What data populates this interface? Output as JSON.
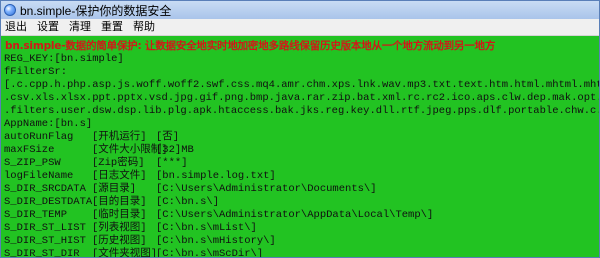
{
  "window": {
    "title": "bn.simple-保护你的数据安全",
    "icon": "app-logo-icon"
  },
  "menu": [
    "退出",
    "设置",
    "清理",
    "重置",
    "帮助"
  ],
  "headline": "bn.simple-数据的简单保护: 让数据安全地实时地加密地多路线保留历史版本地从一个地方流动到另一地方",
  "lines": {
    "reg_key": "REG_KEY:[bn.simple]",
    "filter_label": "fFilterSr:",
    "filter_1": "[.c.cpp.h.php.asp.js.woff.woff2.swf.css.mq4.amr.chm.xps.lnk.wav.mp3.txt.text.htm.html.mhtml.mht.pdf.doc.docx",
    "filter_2": ".csv.xls.xlsx.ppt.pptx.vsd.jpg.gif.png.bmp.java.rar.zip.bat.xml.rc.rc2.ico.aps.clw.dep.mak.opt.sln.vcxproj",
    "filter_3": ".filters.user.dsw.dsp.lib.plg.apk.htaccess.bak.jks.reg.key.dll.rtf.jpeg.pps.dlf.portable.chw.c.c.c.c.c.]",
    "app_name": "AppName:[bn.s]"
  },
  "settings": [
    {
      "key": "autoRunFlag",
      "label": "[开机运行]",
      "value": "[否]"
    },
    {
      "key": "maxFSize",
      "label": "[文件大小限制]",
      "value": "[32]MB"
    },
    {
      "key": "S_ZIP_PSW",
      "label": "[Zip密码]",
      "value": "[***]"
    },
    {
      "key": "logFileName",
      "label": "[日志文件]",
      "value": "[bn.simple.log.txt]"
    },
    {
      "key": "S_DIR_SRCDATA",
      "label": "[源目录]",
      "value": "[C:\\Users\\Administrator\\Documents\\]"
    },
    {
      "key": "S_DIR_DESTDATA",
      "label": "[目的目录]",
      "value": "[C:\\bn.s\\]"
    },
    {
      "key": "S_DIR_TEMP",
      "label": "[临时目录]",
      "value": "[C:\\Users\\Administrator\\AppData\\Local\\Temp\\]"
    },
    {
      "key": "S_DIR_ST_LIST",
      "label": "[列表视图]",
      "value": "[C:\\bn.s\\mList\\]"
    },
    {
      "key": "S_DIR_ST_HIST",
      "label": "[历史视图]",
      "value": "[C:\\bn.s\\mHistory\\]"
    },
    {
      "key": "S_DIR_ST_DIR",
      "label": "[文件夹视图]",
      "value": "[C:\\bn.s\\mScDir\\]"
    }
  ]
}
